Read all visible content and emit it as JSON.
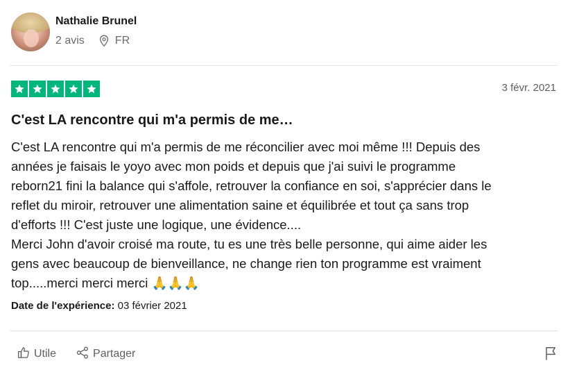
{
  "reviewer": {
    "name": "Nathalie Brunel",
    "reviews_count": "2 avis",
    "country": "FR",
    "avatar_icon": "user-avatar-photo"
  },
  "review": {
    "rating": 5,
    "rating_max": 5,
    "star_color": "#00b67a",
    "date": "3 févr. 2021",
    "title": "C'est LA rencontre qui m'a permis de me…",
    "body_lines": [
      "C'est LA rencontre qui m'a permis de me réconcilier avec moi même !!! Depuis des",
      "années je faisais le yoyo avec mon poids et depuis que j'ai suivi le programme",
      "reborn21 fini la balance qui s'affole, retrouver la confiance en soi, s'apprécier dans le",
      "reflet du miroir, retrouver une alimentation saine et équilibrée et tout ça sans trop",
      "d'efforts !!! C'est juste une logique, une évidence....",
      "Merci John d'avoir croisé ma route, tu es une très belle personne, qui aime aider les",
      "gens avec beaucoup de bienveillance, ne change rien ton programme est vraiment",
      "top.....merci merci merci 🙏🙏🙏"
    ],
    "experience_label": "Date de l'expérience:",
    "experience_date": "03 février 2021"
  },
  "actions": {
    "useful_label": "Utile",
    "share_label": "Partager",
    "icons": [
      "thumbs-up-icon",
      "share-icon",
      "flag-icon",
      "location-pin-icon",
      "star-icon"
    ]
  }
}
